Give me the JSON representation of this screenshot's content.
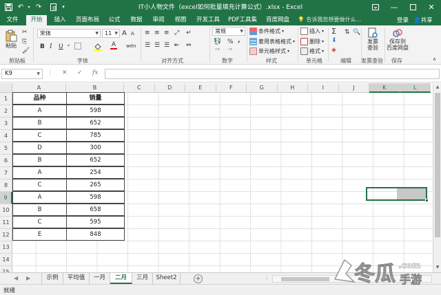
{
  "window": {
    "title": "IT小人物文件（excel如何批量填充计算公式）.xlsx - Excel",
    "undo_icon": "undo-icon",
    "redo_icon": "redo-icon",
    "print_preview_icon": "print-preview-icon",
    "restore_icon": "ribbon-display-icon",
    "minimize_icon": "minimize-icon",
    "maximize_icon": "maximize-icon",
    "close_icon": "close-icon"
  },
  "tabs": [
    "文件",
    "开始",
    "插入",
    "页面布局",
    "公式",
    "数据",
    "审阅",
    "视图",
    "开发工具",
    "PDF工具集",
    "百度网盘"
  ],
  "active_tab": "开始",
  "tell_me": "告诉我您想要做什么...",
  "login": "登录",
  "share": "共享",
  "ribbon": {
    "clipboard": {
      "paste": "粘贴",
      "label": "剪贴板"
    },
    "font": {
      "name": "宋体",
      "size": "11",
      "bold": "B",
      "italic": "I",
      "underline": "U",
      "grow": "A",
      "shrink": "A",
      "font_color_glyph": "A",
      "phonetic_glyph": "wén",
      "label": "字体"
    },
    "alignment": {
      "label": "对齐方式"
    },
    "number": {
      "format": "常规",
      "percent": "%",
      "comma": ",",
      "label": "数字"
    },
    "styles": {
      "conditional": "条件格式",
      "table": "套用表格格式",
      "cell": "单元格样式",
      "label": "样式"
    },
    "cells": {
      "insert": "插入",
      "delete": "删除",
      "format": "格式",
      "label": "单元格"
    },
    "editing": {
      "sum": "Σ",
      "label": "编辑"
    },
    "invoice": {
      "check": "发票\n查验",
      "label": "发票查验"
    },
    "save": {
      "save_to": "保存到\n百度网盘",
      "label": "保存"
    }
  },
  "formula_bar": {
    "cell_ref": "K9",
    "cancel": "✕",
    "confirm": "✓",
    "fx": "fx",
    "value": ""
  },
  "columns": [
    "A",
    "B",
    "C",
    "D",
    "E",
    "F",
    "G",
    "H",
    "I",
    "J",
    "K",
    "L"
  ],
  "rows": [
    "1",
    "2",
    "3",
    "4",
    "5",
    "6",
    "7",
    "8",
    "9",
    "10",
    "11",
    "12",
    "13",
    "14",
    "15"
  ],
  "table": {
    "headers": [
      "品种",
      "销量"
    ],
    "rows": [
      [
        "A",
        "598"
      ],
      [
        "B",
        "652"
      ],
      [
        "C",
        "785"
      ],
      [
        "D",
        "300"
      ],
      [
        "B",
        "652"
      ],
      [
        "A",
        "254"
      ],
      [
        "C",
        "265"
      ],
      [
        "A",
        "598"
      ],
      [
        "B",
        "658"
      ],
      [
        "C",
        "595"
      ],
      [
        "E",
        "848"
      ]
    ]
  },
  "sheets": [
    "示例",
    "平均值",
    "一月",
    "二月",
    "三月",
    "Sheet2"
  ],
  "active_sheet": "二月",
  "add_sheet": "+",
  "status": "就绪",
  "watermark": {
    "text": "冬瓜",
    "sub": "手游",
    "com": ".com"
  },
  "colors": {
    "accent": "#217346",
    "selection_fill": "#c8c8c8"
  }
}
